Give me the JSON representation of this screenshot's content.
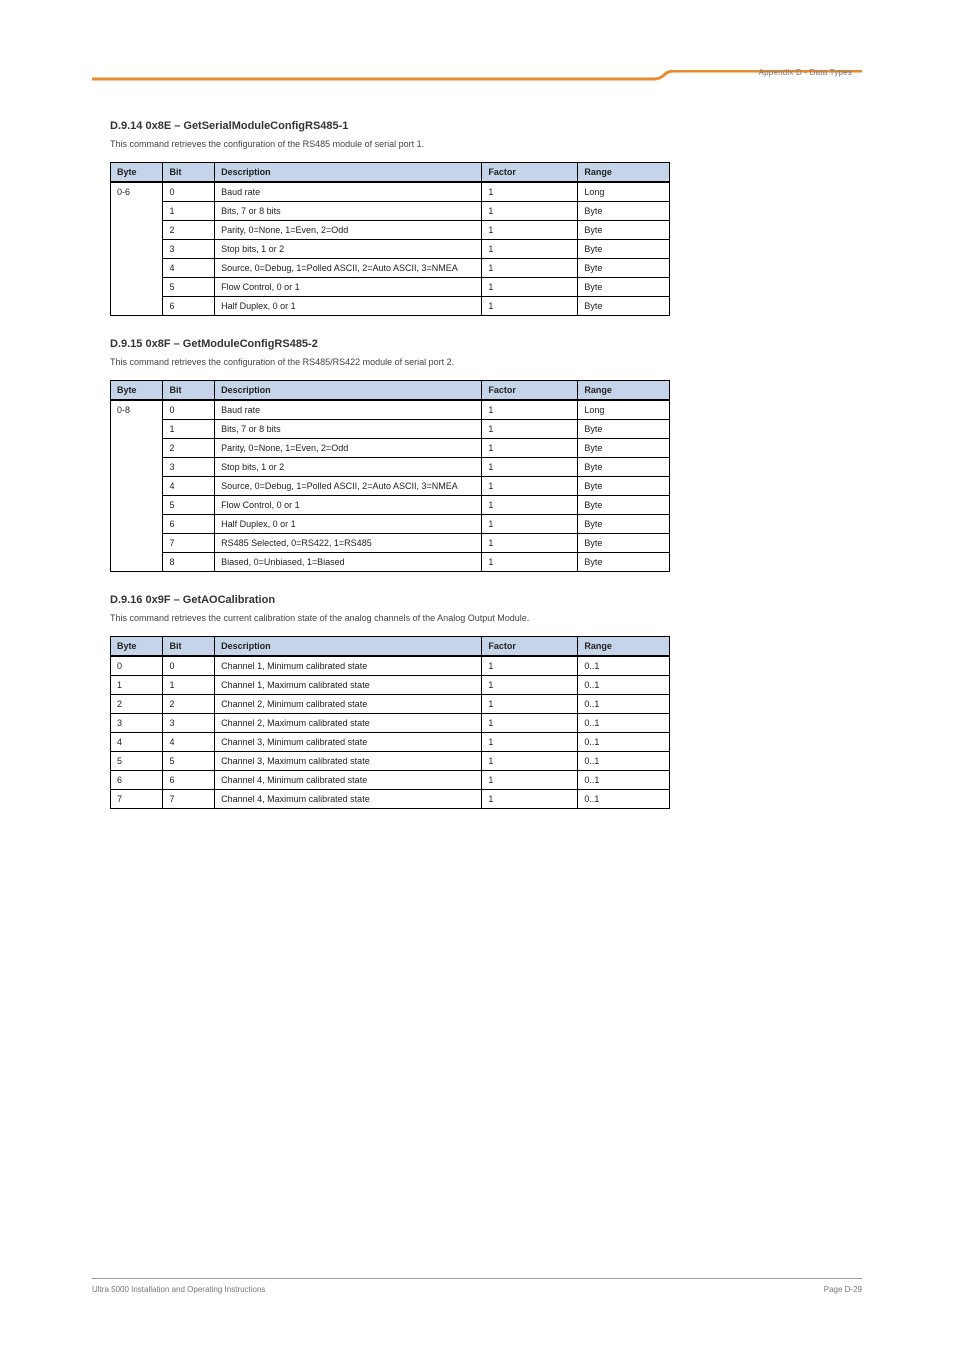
{
  "header": {
    "breadcrumb": "Appendix D - Data Types"
  },
  "tableHeaders": [
    "Byte",
    "Bit",
    "Description",
    "Factor",
    "Range"
  ],
  "sections": [
    {
      "title": "D.9.14 0x8E – GetSerialModuleConfigRS485-1",
      "desc": "This command retrieves the configuration of the RS485 module of serial port 1.",
      "byteSpan": true,
      "rows": [
        {
          "byte": "0-6",
          "bit": "0",
          "desc": "Baud rate",
          "factor": "1",
          "range": "Long"
        },
        {
          "byte": "",
          "bit": "1",
          "desc": "Bits, 7 or 8 bits",
          "factor": "1",
          "range": "Byte"
        },
        {
          "byte": "",
          "bit": "2",
          "desc": "Parity, 0=None, 1=Even, 2=Odd",
          "factor": "1",
          "range": "Byte"
        },
        {
          "byte": "",
          "bit": "3",
          "desc": "Stop bits, 1 or 2",
          "factor": "1",
          "range": "Byte"
        },
        {
          "byte": "",
          "bit": "4",
          "desc": "Source, 0=Debug, 1=Polled ASCII, 2=Auto ASCII, 3=NMEA",
          "factor": "1",
          "range": "Byte"
        },
        {
          "byte": "",
          "bit": "5",
          "desc": "Flow Control, 0 or 1",
          "factor": "1",
          "range": "Byte"
        },
        {
          "byte": "",
          "bit": "6",
          "desc": "Half Duplex, 0 or 1",
          "factor": "1",
          "range": "Byte"
        }
      ]
    },
    {
      "title": "D.9.15 0x8F – GetModuleConfigRS485-2",
      "desc": "This command retrieves the configuration of the RS485/RS422 module of serial port 2.",
      "byteSpan": true,
      "rows": [
        {
          "byte": "0-8",
          "bit": "0",
          "desc": "Baud rate",
          "factor": "1",
          "range": "Long"
        },
        {
          "byte": "",
          "bit": "1",
          "desc": "Bits, 7 or 8 bits",
          "factor": "1",
          "range": "Byte"
        },
        {
          "byte": "",
          "bit": "2",
          "desc": "Parity, 0=None, 1=Even, 2=Odd",
          "factor": "1",
          "range": "Byte"
        },
        {
          "byte": "",
          "bit": "3",
          "desc": "Stop bits, 1 or 2",
          "factor": "1",
          "range": "Byte"
        },
        {
          "byte": "",
          "bit": "4",
          "desc": "Source, 0=Debug, 1=Polled ASCII, 2=Auto ASCII, 3=NMEA",
          "factor": "1",
          "range": "Byte"
        },
        {
          "byte": "",
          "bit": "5",
          "desc": "Flow Control, 0 or 1",
          "factor": "1",
          "range": "Byte"
        },
        {
          "byte": "",
          "bit": "6",
          "desc": "Half Duplex, 0 or 1",
          "factor": "1",
          "range": "Byte"
        },
        {
          "byte": "",
          "bit": "7",
          "desc": "RS485 Selected, 0=RS422, 1=RS485",
          "factor": "1",
          "range": "Byte"
        },
        {
          "byte": "",
          "bit": "8",
          "desc": "Biased, 0=Unbiased, 1=Biased",
          "factor": "1",
          "range": "Byte"
        }
      ]
    },
    {
      "title": "D.9.16 0x9F – GetAOCalibration",
      "desc": "This command retrieves the current calibration state of the analog channels of the Analog Output Module.",
      "byteSpan": false,
      "rows": [
        {
          "byte": "0",
          "bit": "0",
          "desc": "Channel 1, Minimum calibrated state",
          "factor": "1",
          "range": "0..1"
        },
        {
          "byte": "1",
          "bit": "1",
          "desc": "Channel 1, Maximum calibrated state",
          "factor": "1",
          "range": "0..1"
        },
        {
          "byte": "2",
          "bit": "2",
          "desc": "Channel 2, Minimum calibrated state",
          "factor": "1",
          "range": "0..1"
        },
        {
          "byte": "3",
          "bit": "3",
          "desc": "Channel 2, Maximum calibrated state",
          "factor": "1",
          "range": "0..1"
        },
        {
          "byte": "4",
          "bit": "4",
          "desc": "Channel 3, Minimum calibrated state",
          "factor": "1",
          "range": "0..1"
        },
        {
          "byte": "5",
          "bit": "5",
          "desc": "Channel 3, Maximum calibrated state",
          "factor": "1",
          "range": "0..1"
        },
        {
          "byte": "6",
          "bit": "6",
          "desc": "Channel 4, Minimum calibrated state",
          "factor": "1",
          "range": "0..1"
        },
        {
          "byte": "7",
          "bit": "7",
          "desc": "Channel 4, Maximum calibrated state",
          "factor": "1",
          "range": "0..1"
        }
      ]
    }
  ],
  "footer": {
    "left": "Ultra 5000 Installation and Operating Instructions",
    "right": "Page D-29"
  }
}
